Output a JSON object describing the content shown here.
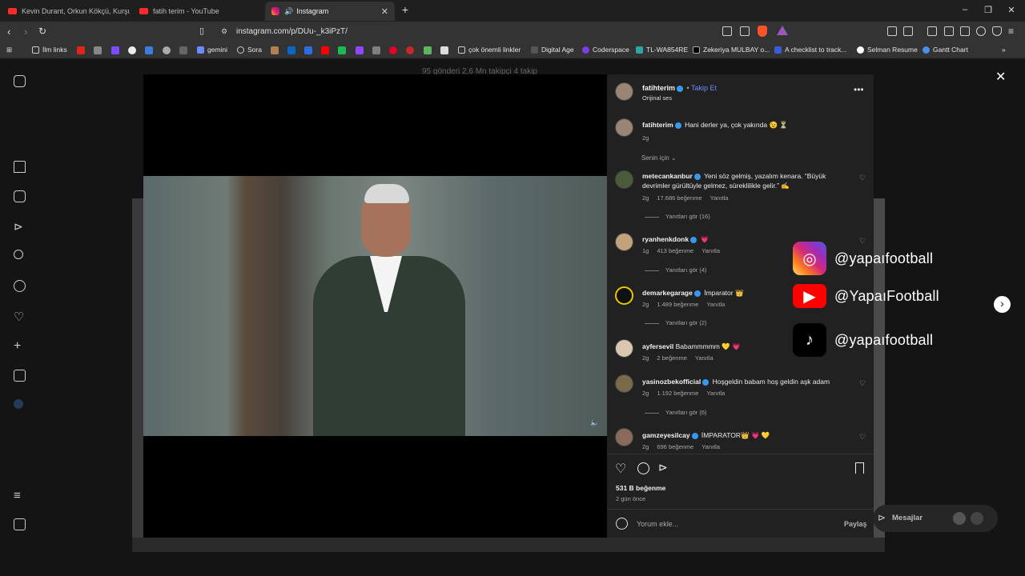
{
  "tabs": [
    {
      "label": "Kevin Durant, Orkun Kökçü, Kurşun D",
      "icon": "youtube-icon"
    },
    {
      "label": "fatih terim - YouTube",
      "icon": "youtube-icon"
    },
    {
      "label": "Instagram",
      "icon": "instagram-icon",
      "active": true
    }
  ],
  "address_bar": {
    "url": "instagram.com/p/DUu-_k3iPzT/"
  },
  "bookmarks": [
    "İlm links",
    "gemini",
    "Sora",
    "çok önemli linkler",
    "Digital Age",
    "Coderspace",
    "TL-WA854RE",
    "Zekeriya MULBAY o...",
    "A checklist to track...",
    "Selman Resume",
    "Gantt Chart"
  ],
  "background_profile_stats": "95 gönderi   2,6 Mn takipçi   4 takip",
  "post_header": {
    "username": "fatihterim",
    "follow_label": "Takip Et",
    "subtitle": "Orijinal ses"
  },
  "caption": {
    "username": "fatihterim",
    "text": "Hani derler ya, çok yakında 😉 ⏳",
    "time": "2g"
  },
  "sort_label": "Senin için",
  "comments": [
    {
      "username": "metecankanbur",
      "text": "Yeni söz gelmiş, yazalım kenara. “Büyük devrimler gürültüyle gelmez, süreklilikle gelir.” ✍️",
      "time": "2g",
      "likes": "17.686 beğenme",
      "reply": "Yanıtla",
      "replies": "Yanıtları gör (16)"
    },
    {
      "username": "ryanhenkdonk",
      "text": "💗",
      "time": "1g",
      "likes": "413 beğenme",
      "reply": "Yanıtla",
      "replies": "Yanıtları gör (4)"
    },
    {
      "username": "demarkegarage",
      "text": "İmparator 👑",
      "time": "2g",
      "likes": "1.489 beğenme",
      "reply": "Yanıtla",
      "replies": "Yanıtları gör (2)"
    },
    {
      "username": "ayfersevil",
      "text": "Babammmmm 💛 💗",
      "time": "2g",
      "likes": "2 beğenme",
      "reply": "Yanıtla",
      "replies": ""
    },
    {
      "username": "yasinozbekofficial",
      "text": "Hoşgeldin babam hoş geldin aşk adam",
      "time": "2g",
      "likes": "1.192 beğenme",
      "reply": "Yanıtla",
      "replies": "Yanıtları gör (6)"
    },
    {
      "username": "gamzeyesilcay",
      "text": "İMPARATOR👑 💗 💛",
      "time": "2g",
      "likes": "696 beğenme",
      "reply": "Yanıtla",
      "replies": ""
    }
  ],
  "likes_total": "531 B beğenme",
  "posted_ago": "2 gün önce",
  "comment_input": {
    "placeholder": "Yorum ekle...",
    "submit_label": "Paylaş"
  },
  "messages_label": "Mesajlar",
  "overlay_brand": [
    {
      "icon": "instagram-icon",
      "handle": "@yapaıfootball"
    },
    {
      "icon": "youtube-icon",
      "handle": "@YapaıFootball"
    },
    {
      "icon": "tiktok-icon",
      "handle": "@yapaıfootball"
    }
  ]
}
